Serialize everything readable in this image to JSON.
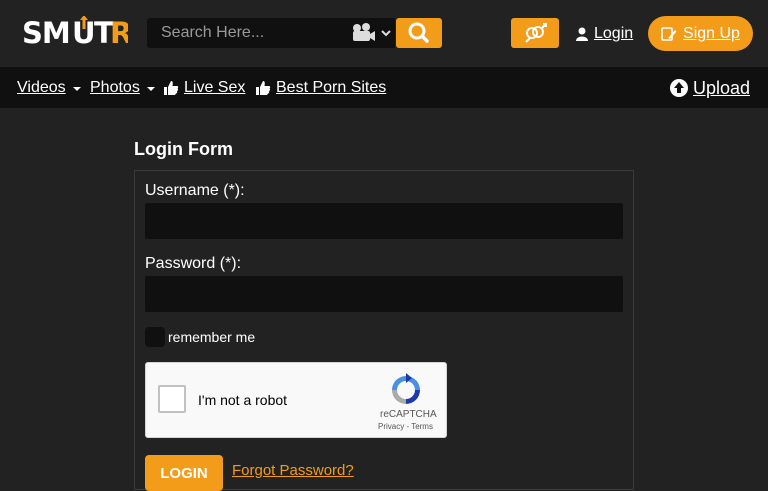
{
  "header": {
    "logo_text": "SMUTR",
    "search_placeholder": "Search Here...",
    "media_type_icon": "video-camera-icon",
    "login_label": "Login",
    "signup_label": "Sign Up"
  },
  "nav": {
    "items": [
      {
        "label": "Videos",
        "has_dropdown": true
      },
      {
        "label": "Photos",
        "has_dropdown": true
      },
      {
        "label": "Live Sex",
        "icon": "thumbs-up-icon"
      },
      {
        "label": "Best Porn Sites",
        "icon": "thumbs-up-icon"
      }
    ],
    "upload_label": "Upload"
  },
  "login_form": {
    "title": "Login Form",
    "username_label": "Username (*):",
    "username_value": "",
    "password_label": "Password (*):",
    "password_value": "",
    "remember_label": "remember me",
    "captcha": {
      "text": "I'm not a robot",
      "brand": "reCAPTCHA",
      "links": "Privacy - Terms"
    },
    "submit_label": "LOGIN",
    "forgot_label": "Forgot Password?"
  },
  "colors": {
    "accent": "#f39c1a",
    "background": "#222222",
    "navbar": "#101010",
    "input": "#101010"
  }
}
